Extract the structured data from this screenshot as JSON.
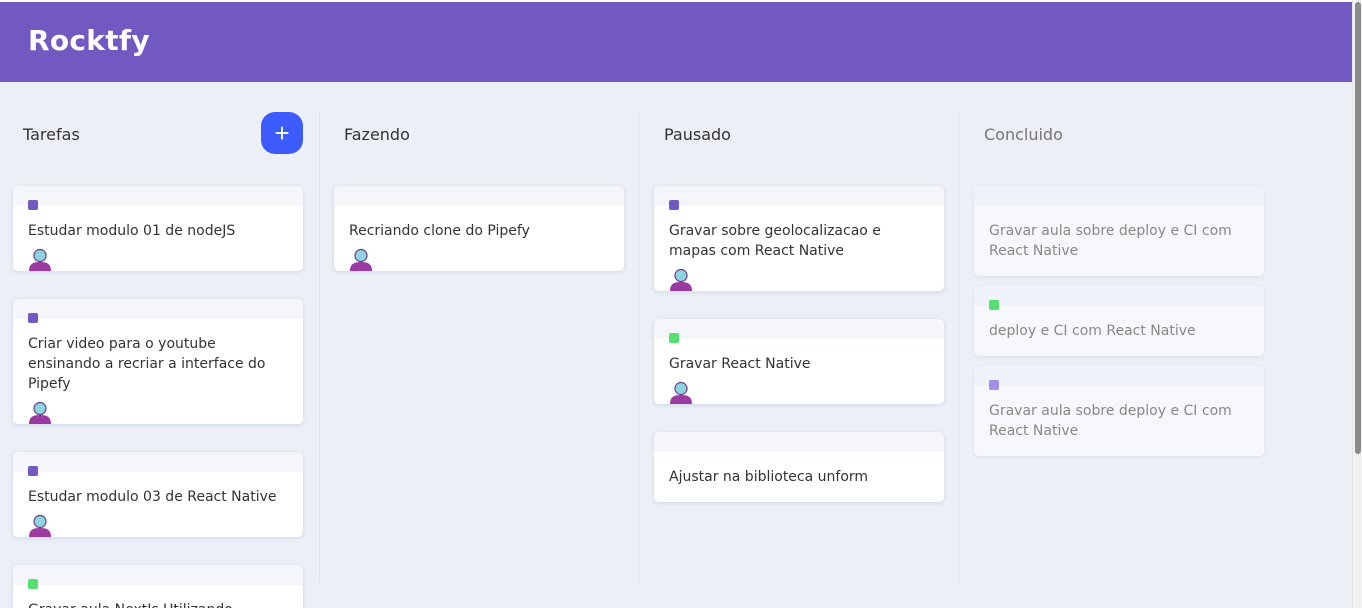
{
  "app": {
    "title": "Rocktfy"
  },
  "colors": {
    "header": "#7159c1",
    "add_button": "#3b5bfd",
    "label_purple": "#7159c1",
    "label_green": "#54e170",
    "label_lavender": "#a58ee8"
  },
  "board": {
    "lists": [
      {
        "title": "Tarefas",
        "add_label": "+",
        "cards": [
          {
            "text": "Estudar modulo 01 de nodeJS",
            "label_color": "#7159c1",
            "has_user": true
          },
          {
            "text": "Criar video para o youtube ensinando a recriar a interface do Pipefy",
            "label_color": "#7159c1",
            "has_user": true
          },
          {
            "text": "Estudar modulo 03 de React Native",
            "label_color": "#7159c1",
            "has_user": true
          },
          {
            "text": "Gravar aula NextJs Utilizando",
            "label_color": "#54e170",
            "has_user": false
          }
        ]
      },
      {
        "title": "Fazendo",
        "cards": [
          {
            "text": "Recriando clone do Pipefy",
            "label_color": null,
            "has_user": true
          }
        ]
      },
      {
        "title": "Pausado",
        "cards": [
          {
            "text": "Gravar sobre geolocalizacao e mapas com React Native",
            "label_color": "#7159c1",
            "has_user": true
          },
          {
            "text": "Gravar React Native",
            "label_color": "#54e170",
            "has_user": true
          },
          {
            "text": "Ajustar na biblioteca unform",
            "label_color": null,
            "has_user": false
          }
        ]
      },
      {
        "title": "Concluido",
        "cards": [
          {
            "text": "Gravar aula sobre deploy e CI com React Native",
            "label_color": null,
            "has_user": false
          },
          {
            "text": "deploy e CI com React Native",
            "label_color": "#54e170",
            "has_user": false
          },
          {
            "text": "Gravar aula sobre deploy e CI com React Native",
            "label_color": "#a58ee8",
            "has_user": false
          }
        ]
      }
    ]
  }
}
